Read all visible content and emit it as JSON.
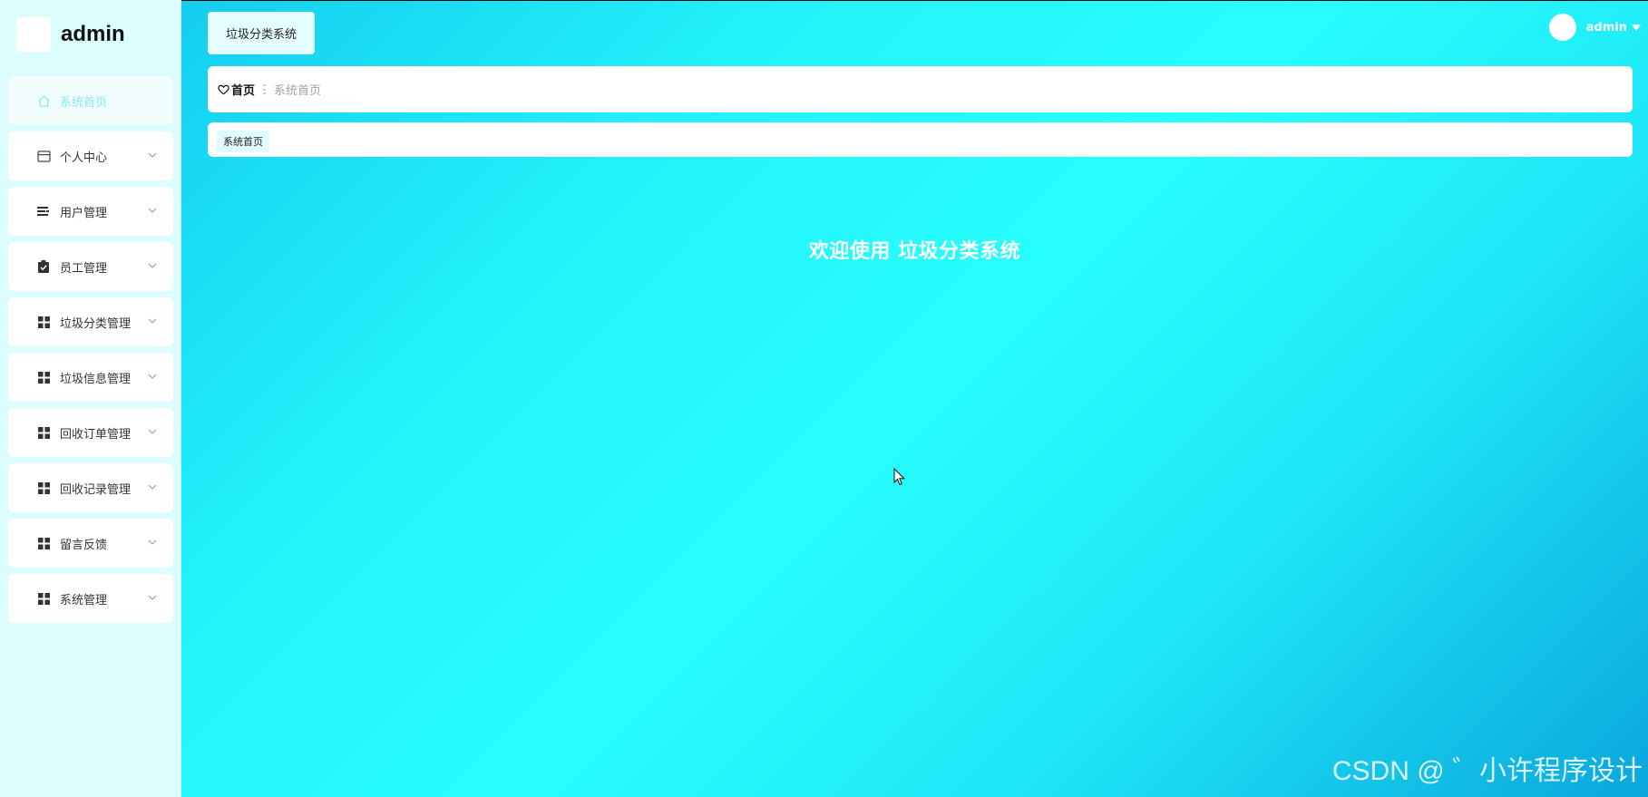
{
  "sidebar": {
    "title": "admin",
    "items": [
      {
        "label": "系统首页",
        "icon": "home-icon",
        "active": true
      },
      {
        "label": "个人中心",
        "icon": "card-icon"
      },
      {
        "label": "用户管理",
        "icon": "list-icon"
      },
      {
        "label": "员工管理",
        "icon": "clipboard-check-icon"
      },
      {
        "label": "垃圾分类管理",
        "icon": "grid-icon"
      },
      {
        "label": "垃圾信息管理",
        "icon": "grid-icon"
      },
      {
        "label": "回收订单管理",
        "icon": "grid-icon"
      },
      {
        "label": "回收记录管理",
        "icon": "grid-icon"
      },
      {
        "label": "留言反馈",
        "icon": "grid-icon"
      },
      {
        "label": "系统管理",
        "icon": "grid-icon"
      }
    ]
  },
  "header": {
    "app_tab": "垃圾分类系统",
    "user_name": "admin"
  },
  "breadcrumb": {
    "home": "首页",
    "current": "系统首页"
  },
  "tags": [
    "系统首页"
  ],
  "main": {
    "welcome": "欢迎使用 垃圾分类系统"
  },
  "watermark": "CSDN @ ゛小许程序设计",
  "colors": {
    "sidebar_bg": "#dcfdfd",
    "main_gradient_start": "#15cdef",
    "main_gradient_mid": "#28fefe",
    "main_gradient_end": "#0aa6dc",
    "active_text": "#8fe6f0",
    "tag_bg": "#e0fcfc"
  }
}
